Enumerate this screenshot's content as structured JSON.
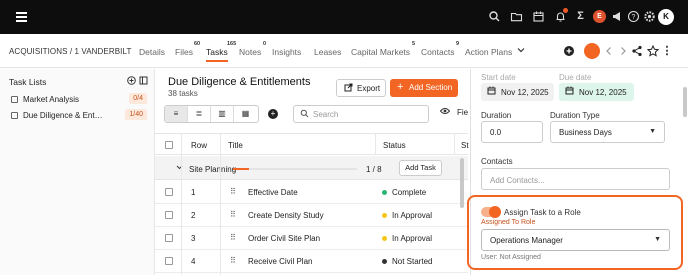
{
  "topbar": {
    "icons": [
      "menu-icon",
      "search-icon",
      "folder-icon",
      "calendar-icon",
      "bell-icon",
      "sigma-icon",
      "megaphone-icon",
      "help-icon",
      "settings-icon"
    ],
    "avatar_e": "E",
    "avatar_k": "K"
  },
  "nav": {
    "breadcrumb": "ACQUISITIONS  / 1 VANDERBILT",
    "items": [
      {
        "label": "Details",
        "badge": ""
      },
      {
        "label": "Files",
        "badge": "60"
      },
      {
        "label": "Tasks",
        "badge": "165"
      },
      {
        "label": "Notes",
        "badge": "0"
      },
      {
        "label": "Insights",
        "badge": ""
      },
      {
        "label": "Leases",
        "badge": ""
      },
      {
        "label": "Capital Markets",
        "badge": "5"
      },
      {
        "label": "Contacts",
        "badge": "9"
      },
      {
        "label": "Action Plans",
        "badge": ""
      }
    ],
    "active": "Tasks",
    "accent": "#f26522"
  },
  "left": {
    "title": "Task Lists",
    "lists": [
      {
        "label": "Market Analysis",
        "count": "0/4"
      },
      {
        "label": "Due Diligence & Ent…",
        "count": "1/40"
      }
    ]
  },
  "main": {
    "title": "Due Diligence & Entitlements",
    "subtitle": "38 tasks",
    "export_label": "Export",
    "add_section_label": "Add Section",
    "search_placeholder": "Search",
    "fields_label": "Fie",
    "columns": {
      "row": "Row",
      "title": "Title",
      "status": "Status",
      "extra": "St"
    },
    "section": {
      "name": "Site Planning",
      "progress": 0.125,
      "fraction": "1 / 8",
      "add_task_label": "Add Task"
    },
    "rows": [
      {
        "num": "1",
        "title": "Effective Date",
        "status": "Complete",
        "status_color": "#2bb673"
      },
      {
        "num": "2",
        "title": "Create Density Study",
        "status": "In Approval",
        "status_color": "#f5c518"
      },
      {
        "num": "3",
        "title": "Order Civil Site Plan",
        "status": "In Approval",
        "status_color": "#f5c518"
      },
      {
        "num": "4",
        "title": "Receive Civil Plan",
        "status": "Not Started",
        "status_color": "#333333"
      }
    ]
  },
  "right": {
    "start_date_label": "Start date",
    "due_date_label": "Due date",
    "start_date": "Nov 12, 2025",
    "due_date": "Nov 12, 2025",
    "duration_label": "Duration",
    "duration_value": "0.0",
    "duration_type_label": "Duration Type",
    "duration_type_value": "Business Days",
    "contacts_label": "Contacts",
    "contacts_placeholder": "Add Contacts...",
    "assign_toggle_label": "Assign Task to a Role",
    "assign_toggle_on": true,
    "assigned_role_label": "Assigned To Role",
    "assigned_role_value": "Operations Manager",
    "user_status": "User: Not Assigned"
  }
}
